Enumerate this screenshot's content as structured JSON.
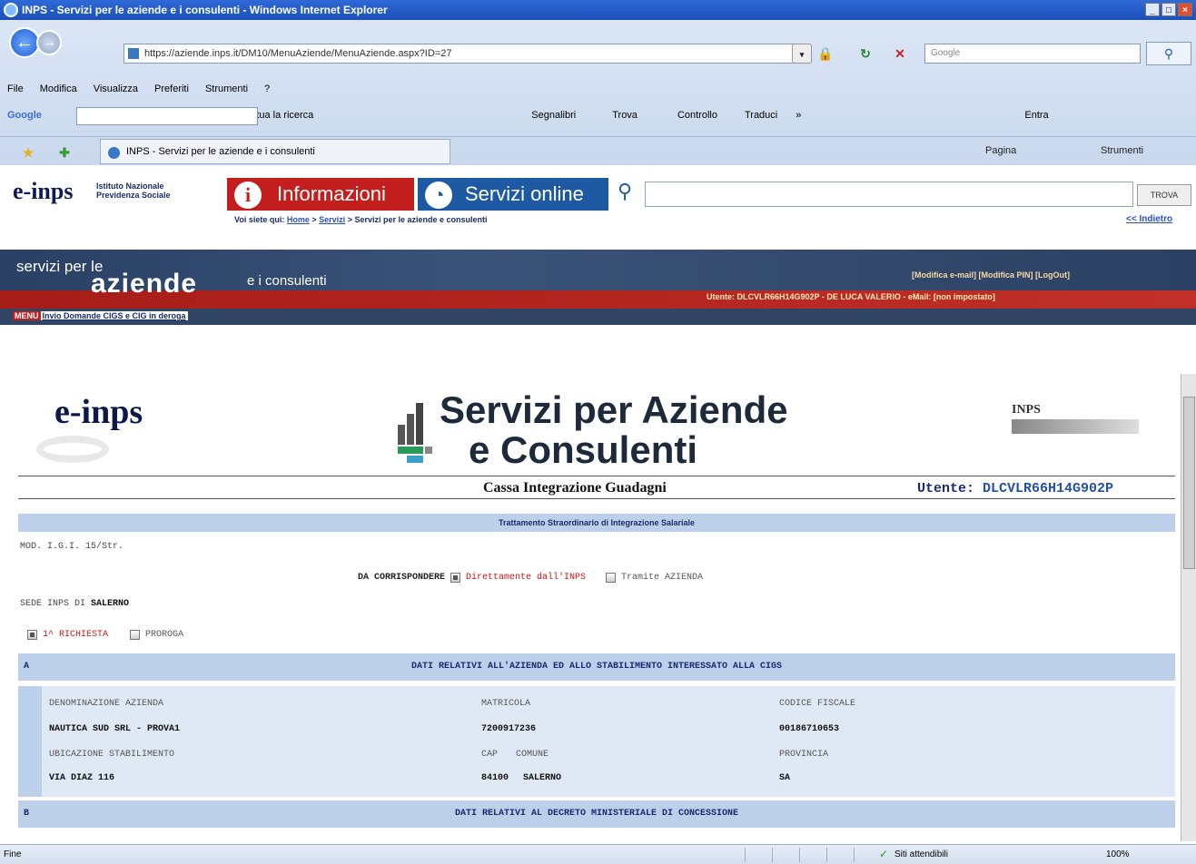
{
  "window": {
    "title": "INPS - Servizi per le aziende e i consulenti - Windows Internet Explorer"
  },
  "browser": {
    "address": "https://aziende.inps.it/DM10/MenuAziende/MenuAziende.aspx?ID=27",
    "search_placeholder": "Google",
    "menu": [
      "File",
      "Modifica",
      "Visualizza",
      "Preferiti",
      "Strumenti",
      "?"
    ],
    "google_bar": {
      "label": "Google",
      "search_btn": "Effettua la ricerca",
      "bookmarks": "Segnalibri",
      "find": "Trova",
      "check": "Controllo",
      "translate": "Traduci",
      "more": "»",
      "login": "Entra"
    },
    "tab_title": "INPS - Servizi per le aziende e i consulenti",
    "cmd": {
      "page": "Pagina",
      "tools": "Strumenti"
    }
  },
  "inps_header": {
    "logo": "e-inps",
    "org_line1": "Istituto Nazionale",
    "org_line2": "Previdenza Sociale",
    "btn_info": "Informazioni",
    "btn_services": "Servizi online",
    "search_btn": "TROVA",
    "crumb_prefix": "Voi siete qui:",
    "crumb_home": "Home",
    "crumb_servizi": "Servizi",
    "crumb_current": "> Servizi per le aziende e consulenti",
    "back_link": "<< Indietro"
  },
  "banner": {
    "small": "servizi per le",
    "big": "aziende",
    "tail": "e i consulenti",
    "links": "[Modifica e-mail] [Modifica PIN] [LogOut]",
    "user": "Utente: DLCVLR66H14G902P - DE LUCA VALERIO - eMail: [non impostato]",
    "menu": "MENU",
    "menu_link": "Invio Domande CIGS e CIG in deroga"
  },
  "page": {
    "logo": "e-inps",
    "title_line1": "Servizi per Aziende",
    "title_line2": "e Consulenti",
    "inps_mark": "INPS",
    "cassa": "Cassa Integrazione Guadagni",
    "utente_label": "Utente:",
    "utente_value": "DLCVLR66H14G902P",
    "trattamento": "Trattamento Straordinario di Integrazione Salariale",
    "mod": "MOD. I.G.I. 15/Str.",
    "da_corr": "DA CORRISPONDERE",
    "dir_inps": "Direttamente dall'INPS",
    "tramite": "Tramite AZIENDA",
    "sede_label": "SEDE INPS DI",
    "sede_value": "SALERNO",
    "richiesta": "1^ RICHIESTA",
    "proroga": "PROROGA"
  },
  "section_a": {
    "letter": "A",
    "title": "DATI RELATIVI ALL'AZIENDA ED ALLO STABILIMENTO INTERESSATO ALLA CIGS",
    "denominazione_label": "DENOMINAZIONE AZIENDA",
    "denominazione": "NAUTICA SUD SRL - PROVA1",
    "matricola_label": "MATRICOLA",
    "matricola": "7200917236",
    "cf_label": "CODICE FISCALE",
    "cf": "00186710653",
    "ubicazione_label": "UBICAZIONE STABILIMENTO",
    "ubicazione": "VIA DIAZ 116",
    "cap_label": "CAP",
    "comune_label": "COMUNE",
    "cap": "84100",
    "comune": "SALERNO",
    "provincia_label": "PROVINCIA",
    "provincia": "SA"
  },
  "section_b": {
    "letter": "B",
    "title": "DATI RELATIVI AL DECRETO MINISTERIALE DI CONCESSIONE"
  },
  "status": {
    "left": "Fine",
    "sites": "Siti attendibili",
    "zoom": "100%"
  }
}
